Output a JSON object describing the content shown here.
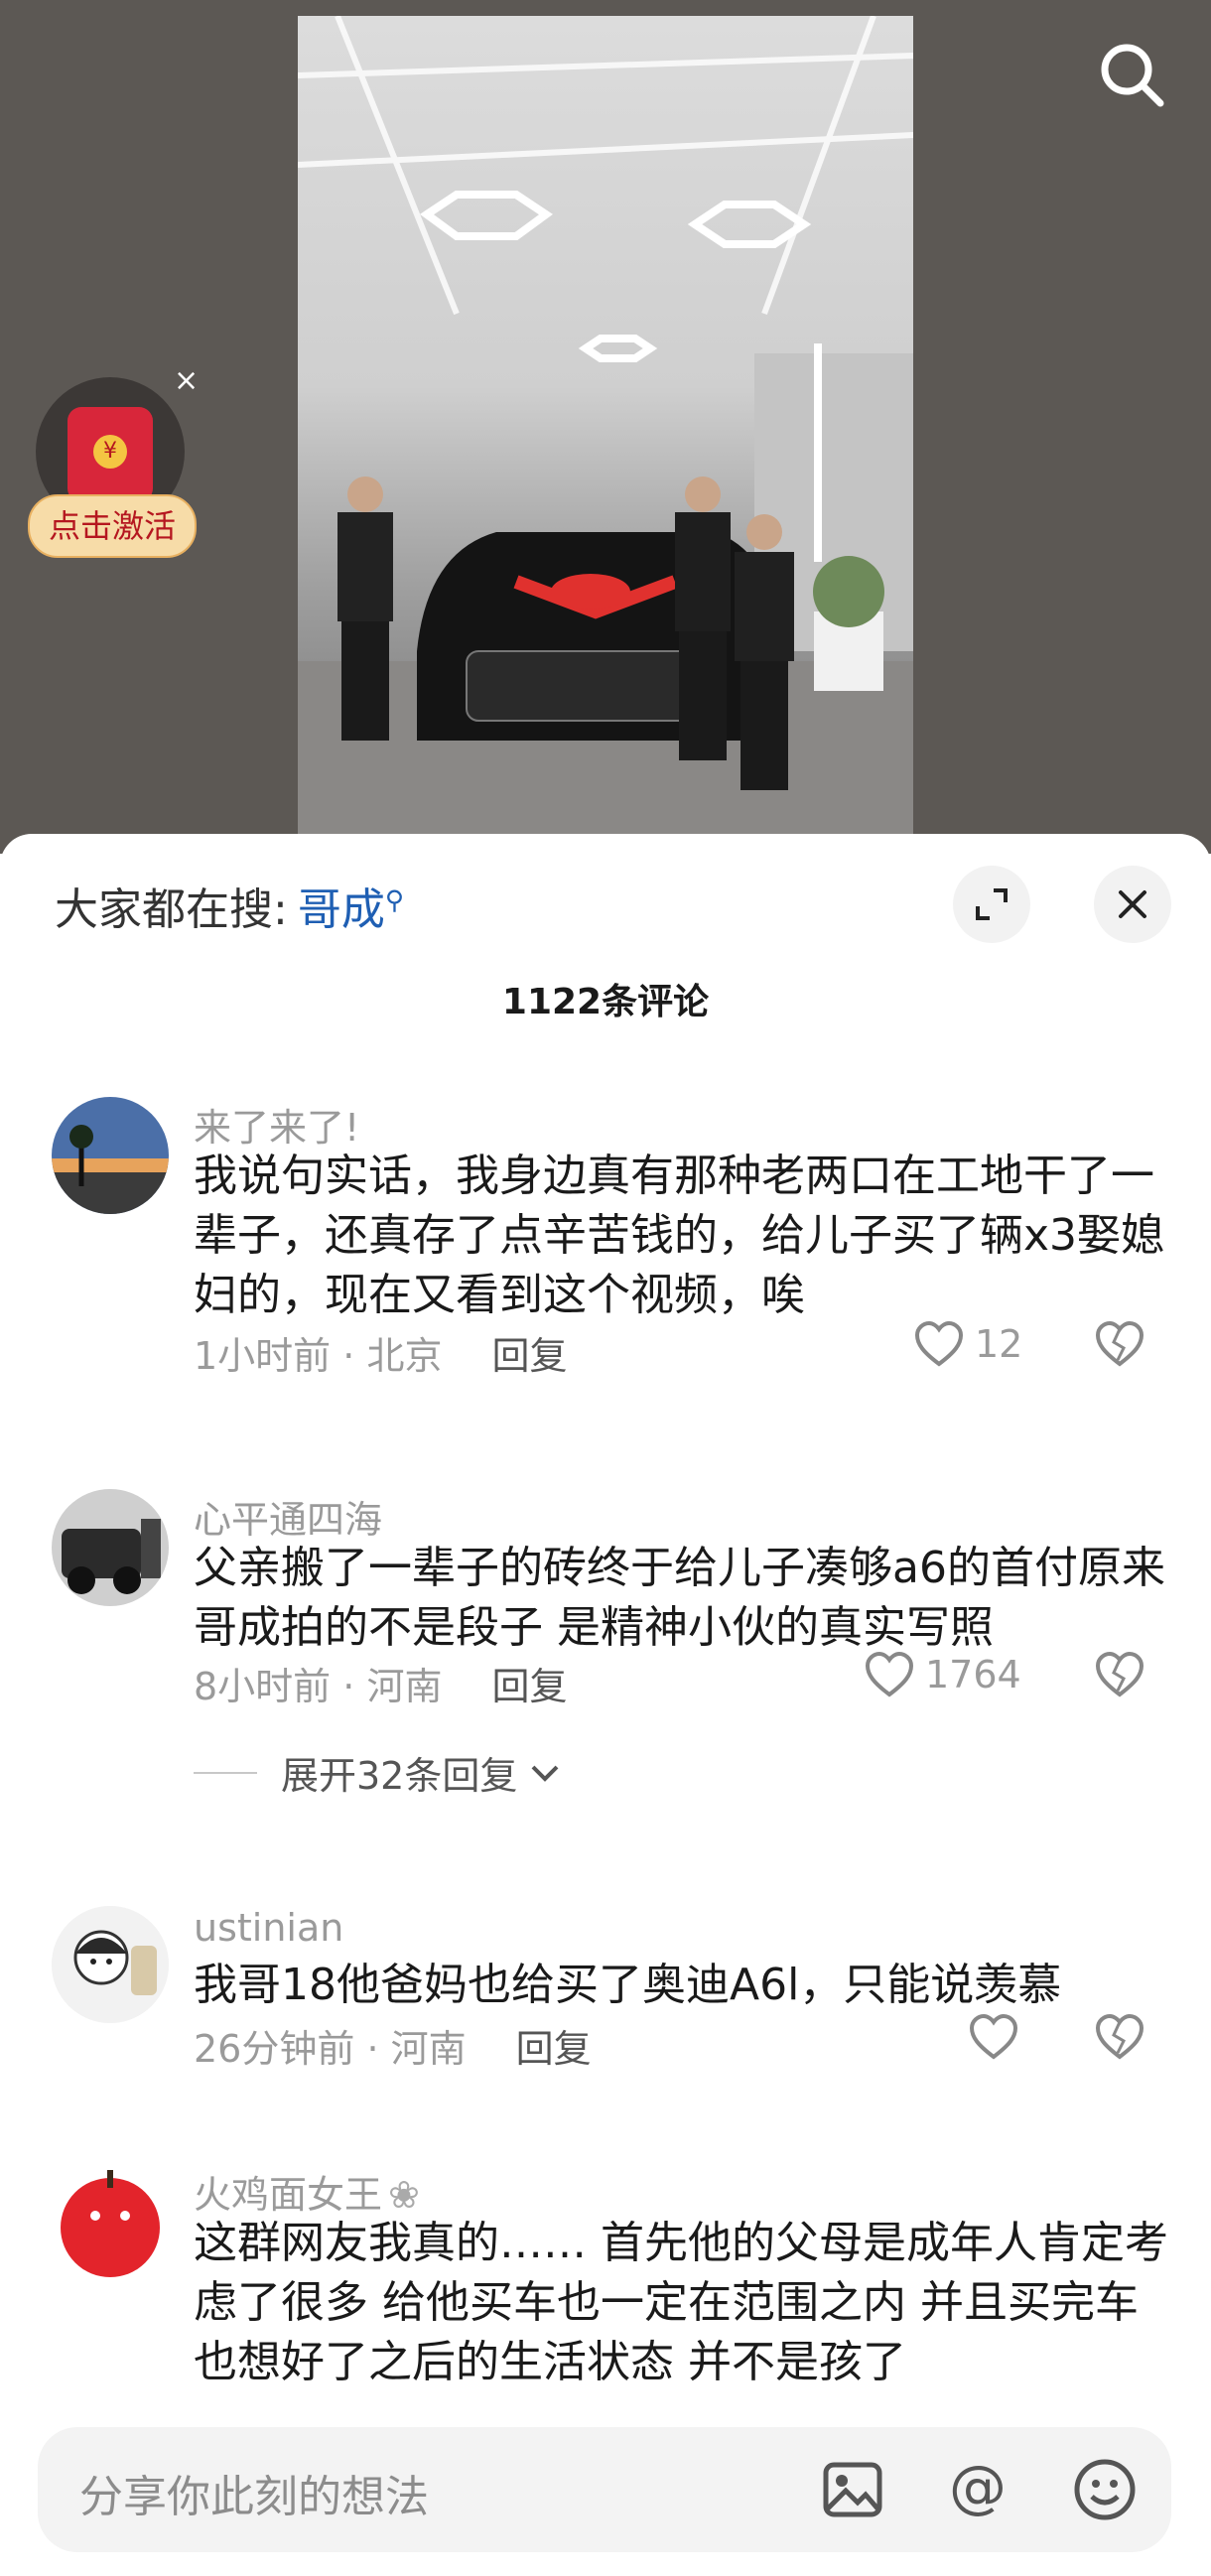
{
  "header": {
    "trending_prefix": "大家都在搜:",
    "trending_keyword": "哥成",
    "comment_count": "1122条评论"
  },
  "promo": {
    "label": "点击激活",
    "close": "×",
    "coin": "¥"
  },
  "comments": [
    {
      "username": "来了来了!",
      "text": "我说句实话，我身边真有那种老两口在工地干了一辈子，还真存了点辛苦钱的，给儿子买了辆x3娶媳妇的，现在又看到这个视频，唉",
      "time": "1小时前",
      "location": "北京",
      "reply": "回复",
      "likes": "12"
    },
    {
      "username": "心平通四海",
      "text": "父亲搬了一辈子的砖终于给儿子凑够a6的首付原来哥成拍的不是段子 是精神小伙的真实写照",
      "time": "8小时前",
      "location": "河南",
      "reply": "回复",
      "likes": "1764",
      "expand": "展开32条回复"
    },
    {
      "username": "ustinian",
      "text": "我哥18他爸妈也给买了奥迪A6l，只能说羡慕",
      "time": "26分钟前",
      "location": "河南",
      "reply": "回复",
      "likes": ""
    },
    {
      "username": "火鸡面女王",
      "text": "这群网友我真的…… 首先他的父母是成年人肯定考虑了很多 给他买车也一定在范围之内 并且买完车也想好了之后的生活状态 并不是孩了",
      "time": "",
      "location": "",
      "reply": "",
      "likes": ""
    }
  ],
  "input": {
    "placeholder": "分享你此刻的想法"
  },
  "colors": {
    "accent": "#1f5fb3",
    "video_bg": "#5c5854",
    "promo_red": "#d8263a"
  }
}
